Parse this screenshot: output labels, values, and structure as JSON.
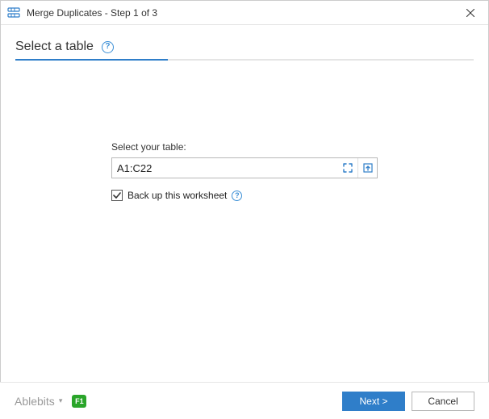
{
  "window": {
    "title": "Merge Duplicates - Step 1 of 3"
  },
  "header": {
    "heading": "Select a table"
  },
  "form": {
    "label": "Select your table:",
    "range_value": "A1:C22",
    "backup_label": "Back up this worksheet",
    "backup_checked": true
  },
  "footer": {
    "brand": "Ablebits",
    "help_badge": "F1",
    "next_label": "Next >",
    "cancel_label": "Cancel"
  }
}
